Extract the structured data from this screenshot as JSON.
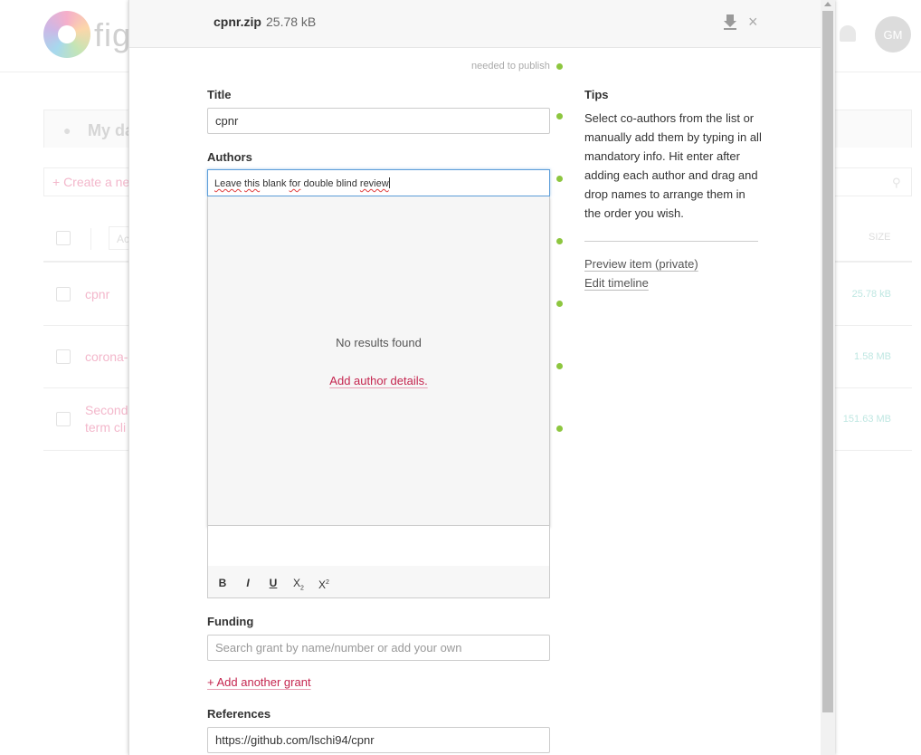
{
  "background": {
    "logo_text": "figs",
    "avatar_initials": "GM",
    "tab_label": "My da",
    "create_label": "+ Create a ne",
    "column_box": "Ac",
    "size_header": "SIZE",
    "rows": [
      {
        "name": "cpnr",
        "size": "25.78 kB"
      },
      {
        "name": "corona-",
        "size": "1.58 MB"
      },
      {
        "name": "Second term cli",
        "size": "151.63 MB"
      }
    ]
  },
  "modal": {
    "file_name": "cpnr.zip",
    "file_size": "25.78 kB",
    "close_glyph": "×",
    "needed_to_publish": "needed to publish",
    "colors": {
      "accent": "#c5254f",
      "publish_dot": "#8dc63f",
      "focus": "#5b9dd9"
    }
  },
  "form": {
    "title_label": "Title",
    "title_value": "cpnr",
    "authors_label": "Authors",
    "authors_text": {
      "w1": "Leave",
      "w2": "this",
      "w3": "blank",
      "w4": "for",
      "w5": "double blind",
      "w6": "review"
    },
    "dropdown": {
      "no_results": "No results found",
      "add_author": "Add author details."
    },
    "toolbar": {
      "bold": "B",
      "italic": "I",
      "underline": "U",
      "subscript": "X",
      "subscript_mark": "2",
      "superscript": "X",
      "superscript_mark": "2"
    },
    "funding_label": "Funding",
    "funding_placeholder": "Search grant by name/number or add your own",
    "add_grant": "+ Add another grant",
    "references_label": "References",
    "references_value": "https://github.com/lschi94/cpnr"
  },
  "tips": {
    "title": "Tips",
    "text": "Select co-authors from the list or manually add them by typing in all mandatory info. Hit enter after adding each author and drag and drop names to arrange them in the order you wish.",
    "preview_link": "Preview item (private)",
    "timeline_link": "Edit timeline"
  }
}
